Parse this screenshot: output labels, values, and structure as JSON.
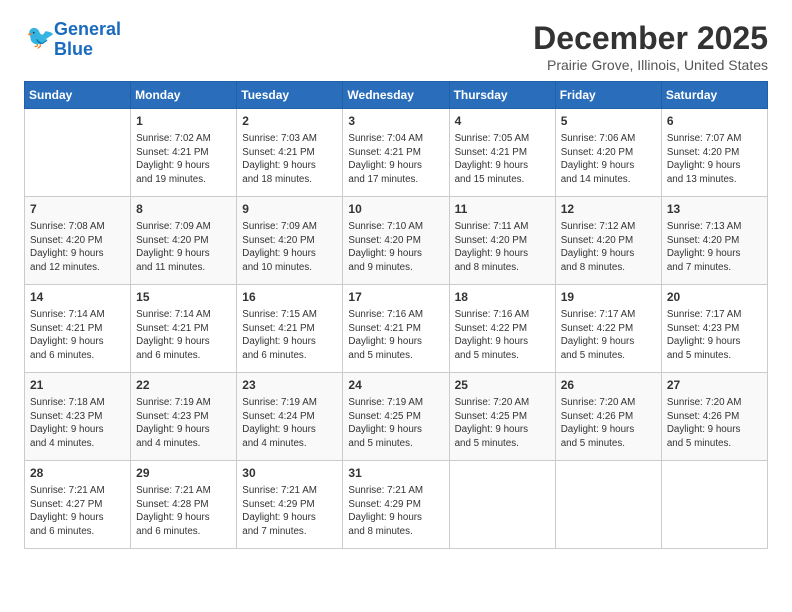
{
  "logo": {
    "line1": "General",
    "line2": "Blue"
  },
  "title": "December 2025",
  "location": "Prairie Grove, Illinois, United States",
  "weekdays": [
    "Sunday",
    "Monday",
    "Tuesday",
    "Wednesday",
    "Thursday",
    "Friday",
    "Saturday"
  ],
  "weeks": [
    [
      {
        "day": "",
        "info": ""
      },
      {
        "day": "1",
        "info": "Sunrise: 7:02 AM\nSunset: 4:21 PM\nDaylight: 9 hours\nand 19 minutes."
      },
      {
        "day": "2",
        "info": "Sunrise: 7:03 AM\nSunset: 4:21 PM\nDaylight: 9 hours\nand 18 minutes."
      },
      {
        "day": "3",
        "info": "Sunrise: 7:04 AM\nSunset: 4:21 PM\nDaylight: 9 hours\nand 17 minutes."
      },
      {
        "day": "4",
        "info": "Sunrise: 7:05 AM\nSunset: 4:21 PM\nDaylight: 9 hours\nand 15 minutes."
      },
      {
        "day": "5",
        "info": "Sunrise: 7:06 AM\nSunset: 4:20 PM\nDaylight: 9 hours\nand 14 minutes."
      },
      {
        "day": "6",
        "info": "Sunrise: 7:07 AM\nSunset: 4:20 PM\nDaylight: 9 hours\nand 13 minutes."
      }
    ],
    [
      {
        "day": "7",
        "info": "Sunrise: 7:08 AM\nSunset: 4:20 PM\nDaylight: 9 hours\nand 12 minutes."
      },
      {
        "day": "8",
        "info": "Sunrise: 7:09 AM\nSunset: 4:20 PM\nDaylight: 9 hours\nand 11 minutes."
      },
      {
        "day": "9",
        "info": "Sunrise: 7:09 AM\nSunset: 4:20 PM\nDaylight: 9 hours\nand 10 minutes."
      },
      {
        "day": "10",
        "info": "Sunrise: 7:10 AM\nSunset: 4:20 PM\nDaylight: 9 hours\nand 9 minutes."
      },
      {
        "day": "11",
        "info": "Sunrise: 7:11 AM\nSunset: 4:20 PM\nDaylight: 9 hours\nand 8 minutes."
      },
      {
        "day": "12",
        "info": "Sunrise: 7:12 AM\nSunset: 4:20 PM\nDaylight: 9 hours\nand 8 minutes."
      },
      {
        "day": "13",
        "info": "Sunrise: 7:13 AM\nSunset: 4:20 PM\nDaylight: 9 hours\nand 7 minutes."
      }
    ],
    [
      {
        "day": "14",
        "info": "Sunrise: 7:14 AM\nSunset: 4:21 PM\nDaylight: 9 hours\nand 6 minutes."
      },
      {
        "day": "15",
        "info": "Sunrise: 7:14 AM\nSunset: 4:21 PM\nDaylight: 9 hours\nand 6 minutes."
      },
      {
        "day": "16",
        "info": "Sunrise: 7:15 AM\nSunset: 4:21 PM\nDaylight: 9 hours\nand 6 minutes."
      },
      {
        "day": "17",
        "info": "Sunrise: 7:16 AM\nSunset: 4:21 PM\nDaylight: 9 hours\nand 5 minutes."
      },
      {
        "day": "18",
        "info": "Sunrise: 7:16 AM\nSunset: 4:22 PM\nDaylight: 9 hours\nand 5 minutes."
      },
      {
        "day": "19",
        "info": "Sunrise: 7:17 AM\nSunset: 4:22 PM\nDaylight: 9 hours\nand 5 minutes."
      },
      {
        "day": "20",
        "info": "Sunrise: 7:17 AM\nSunset: 4:23 PM\nDaylight: 9 hours\nand 5 minutes."
      }
    ],
    [
      {
        "day": "21",
        "info": "Sunrise: 7:18 AM\nSunset: 4:23 PM\nDaylight: 9 hours\nand 4 minutes."
      },
      {
        "day": "22",
        "info": "Sunrise: 7:19 AM\nSunset: 4:23 PM\nDaylight: 9 hours\nand 4 minutes."
      },
      {
        "day": "23",
        "info": "Sunrise: 7:19 AM\nSunset: 4:24 PM\nDaylight: 9 hours\nand 4 minutes."
      },
      {
        "day": "24",
        "info": "Sunrise: 7:19 AM\nSunset: 4:25 PM\nDaylight: 9 hours\nand 5 minutes."
      },
      {
        "day": "25",
        "info": "Sunrise: 7:20 AM\nSunset: 4:25 PM\nDaylight: 9 hours\nand 5 minutes."
      },
      {
        "day": "26",
        "info": "Sunrise: 7:20 AM\nSunset: 4:26 PM\nDaylight: 9 hours\nand 5 minutes."
      },
      {
        "day": "27",
        "info": "Sunrise: 7:20 AM\nSunset: 4:26 PM\nDaylight: 9 hours\nand 5 minutes."
      }
    ],
    [
      {
        "day": "28",
        "info": "Sunrise: 7:21 AM\nSunset: 4:27 PM\nDaylight: 9 hours\nand 6 minutes."
      },
      {
        "day": "29",
        "info": "Sunrise: 7:21 AM\nSunset: 4:28 PM\nDaylight: 9 hours\nand 6 minutes."
      },
      {
        "day": "30",
        "info": "Sunrise: 7:21 AM\nSunset: 4:29 PM\nDaylight: 9 hours\nand 7 minutes."
      },
      {
        "day": "31",
        "info": "Sunrise: 7:21 AM\nSunset: 4:29 PM\nDaylight: 9 hours\nand 8 minutes."
      },
      {
        "day": "",
        "info": ""
      },
      {
        "day": "",
        "info": ""
      },
      {
        "day": "",
        "info": ""
      }
    ]
  ]
}
